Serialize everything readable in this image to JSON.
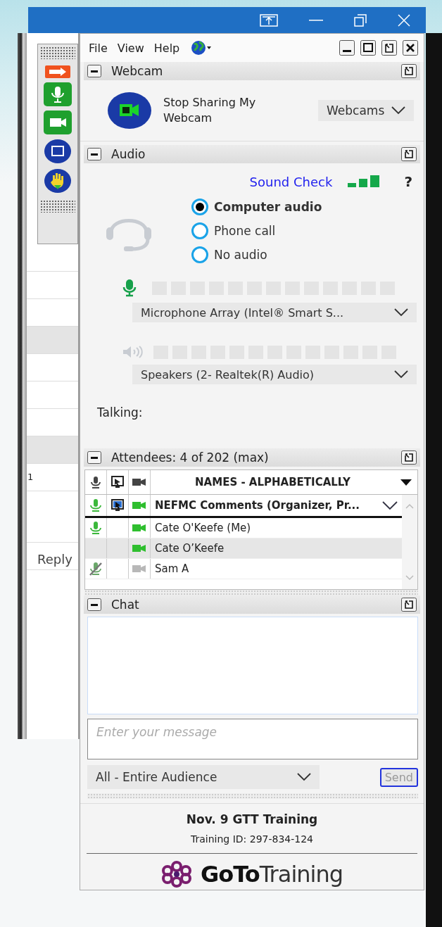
{
  "background_window": {
    "cut_text": "1",
    "reply_label": "Reply"
  },
  "menu": [
    {
      "label": "File"
    },
    {
      "label": "View"
    },
    {
      "label": "Help"
    }
  ],
  "webcam": {
    "title": "Webcam",
    "share_button": "Stop Sharing My Webcam",
    "dropdown": "Webcams"
  },
  "audio": {
    "title": "Audio",
    "sound_check": "Sound Check",
    "help": "?",
    "options": [
      {
        "label": "Computer audio",
        "selected": true
      },
      {
        "label": "Phone call",
        "selected": false
      },
      {
        "label": "No audio",
        "selected": false
      }
    ],
    "mic_meter": {
      "level": 0
    },
    "mic_device": "Microphone  Array  (Intel®  Smart  S...",
    "speaker_meter": {
      "level": 0
    },
    "speaker_device": "Speakers (2- Realtek(R) Audio)",
    "talking_label": "Talking:"
  },
  "attendees": {
    "title": "Attendees:  4 of 202 (max)",
    "header": "NAMES - ALPHABETICALLY",
    "rows": [
      {
        "name": "NEFMC Comments (Organizer, Pr...",
        "organizer": true,
        "mic": true,
        "mic_muted": false,
        "screen": true,
        "webcam": true,
        "selected": false
      },
      {
        "name": "Cate O'Keefe (Me)",
        "organizer": false,
        "mic": true,
        "mic_muted": false,
        "screen": false,
        "webcam": true,
        "selected": false
      },
      {
        "name": "Cate O’Keefe",
        "organizer": false,
        "mic": false,
        "screen": false,
        "webcam": true,
        "selected": true
      },
      {
        "name": "Sam A",
        "organizer": false,
        "mic": true,
        "mic_muted": true,
        "screen": false,
        "webcam": false,
        "selected": false
      }
    ]
  },
  "chat": {
    "title": "Chat",
    "placeholder": "Enter your message",
    "audience": "All - Entire Audience",
    "send": "Send",
    "send_disabled": true
  },
  "footer": {
    "session": "Nov. 9 GTT Training",
    "training_id": "Training ID: 297-834-124",
    "logo": "**GoTo**Training"
  }
}
